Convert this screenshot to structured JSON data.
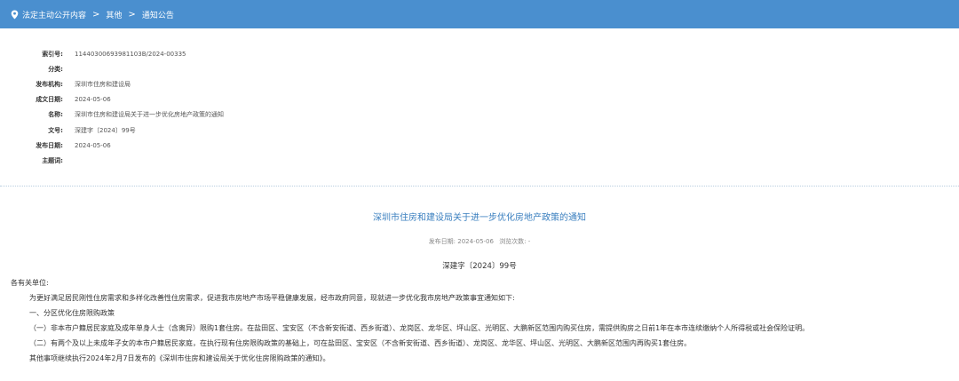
{
  "breadcrumb": {
    "items": [
      "法定主动公开内容",
      "其他",
      "通知公告"
    ],
    "separator": ">"
  },
  "metadata": [
    {
      "label": "索引号:",
      "value": "11440300693981103B/2024-00335"
    },
    {
      "label": "分类:",
      "value": ""
    },
    {
      "label": "发布机构:",
      "value": "深圳市住房和建设局"
    },
    {
      "label": "成文日期:",
      "value": "2024-05-06"
    },
    {
      "label": "名称:",
      "value": "深圳市住房和建设局关于进一步优化房地产政策的通知"
    },
    {
      "label": "文号:",
      "value": "深建字〔2024〕99号"
    },
    {
      "label": "发布日期:",
      "value": "2024-05-06"
    },
    {
      "label": "主题词:",
      "value": ""
    }
  ],
  "document": {
    "title": "深圳市住房和建设局关于进一步优化房地产政策的通知",
    "publish_info": "发布日期: 2024-05-06",
    "view_info": "浏览次数: -",
    "doc_number": "深建字〔2024〕99号",
    "paragraphs": [
      {
        "text": "各有关单位:",
        "indent": false
      },
      {
        "text": "为更好满足居民刚性住房需求和多样化改善性住房需求，促进我市房地产市场平稳健康发展，经市政府同意，现就进一步优化我市房地产政策事宜通知如下:",
        "indent": true
      },
      {
        "text": "一、分区优化住房限购政策",
        "indent": true
      },
      {
        "text": "（一）非本市户籍居民家庭及成年单身人士（含离异）限购1套住房。在盐田区、宝安区（不含新安街道、西乡街道）、龙岗区、龙华区、坪山区、光明区、大鹏新区范围内购买住房，需提供购房之日前1年在本市连续缴纳个人所得税或社会保险证明。",
        "indent": true
      },
      {
        "text": "（二）有两个及以上未成年子女的本市户籍居民家庭，在执行现有住房限购政策的基础上，可在盐田区、宝安区（不含新安街道、西乡街道）、龙岗区、龙华区、坪山区、光明区、大鹏新区范围内再购买1套住房。",
        "indent": true
      },
      {
        "text": "其他事项继续执行2024年2月7日发布的《深圳市住房和建设局关于优化住房限购政策的通知》。",
        "indent": true
      }
    ]
  },
  "colors": {
    "topbar_bg": "#4a8fcf",
    "title_color": "#3a7fbf"
  },
  "icons": {
    "location": "map-pin-icon"
  }
}
